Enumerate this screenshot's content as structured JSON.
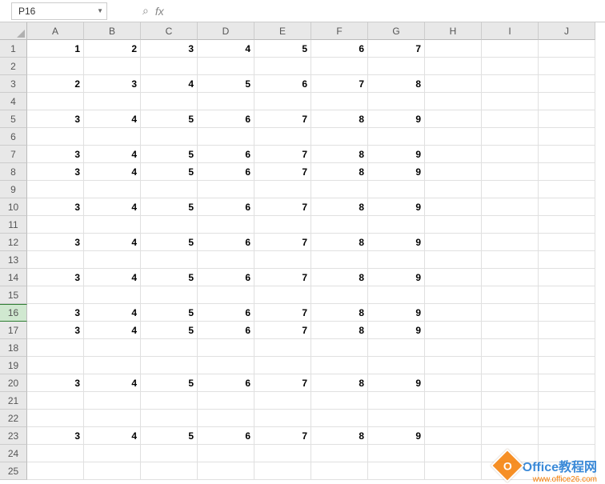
{
  "name_box": "P16",
  "fx_label": "fx",
  "formula_value": "",
  "columns": [
    "A",
    "B",
    "C",
    "D",
    "E",
    "F",
    "G",
    "H",
    "I",
    "J"
  ],
  "row_count": 25,
  "active_row": 16,
  "chart_data": {
    "type": "table",
    "rows": [
      {
        "r": 1,
        "v": [
          "1",
          "2",
          "3",
          "4",
          "5",
          "6",
          "7",
          "",
          "",
          ""
        ]
      },
      {
        "r": 2,
        "v": [
          "",
          "",
          "",
          "",
          "",
          "",
          "",
          "",
          "",
          ""
        ]
      },
      {
        "r": 3,
        "v": [
          "2",
          "3",
          "4",
          "5",
          "6",
          "7",
          "8",
          "",
          "",
          ""
        ]
      },
      {
        "r": 4,
        "v": [
          "",
          "",
          "",
          "",
          "",
          "",
          "",
          "",
          "",
          ""
        ]
      },
      {
        "r": 5,
        "v": [
          "3",
          "4",
          "5",
          "6",
          "7",
          "8",
          "9",
          "",
          "",
          ""
        ]
      },
      {
        "r": 6,
        "v": [
          "",
          "",
          "",
          "",
          "",
          "",
          "",
          "",
          "",
          ""
        ]
      },
      {
        "r": 7,
        "v": [
          "3",
          "4",
          "5",
          "6",
          "7",
          "8",
          "9",
          "",
          "",
          ""
        ]
      },
      {
        "r": 8,
        "v": [
          "3",
          "4",
          "5",
          "6",
          "7",
          "8",
          "9",
          "",
          "",
          ""
        ]
      },
      {
        "r": 9,
        "v": [
          "",
          "",
          "",
          "",
          "",
          "",
          "",
          "",
          "",
          ""
        ]
      },
      {
        "r": 10,
        "v": [
          "3",
          "4",
          "5",
          "6",
          "7",
          "8",
          "9",
          "",
          "",
          ""
        ]
      },
      {
        "r": 11,
        "v": [
          "",
          "",
          "",
          "",
          "",
          "",
          "",
          "",
          "",
          ""
        ]
      },
      {
        "r": 12,
        "v": [
          "3",
          "4",
          "5",
          "6",
          "7",
          "8",
          "9",
          "",
          "",
          ""
        ]
      },
      {
        "r": 13,
        "v": [
          "",
          "",
          "",
          "",
          "",
          "",
          "",
          "",
          "",
          ""
        ]
      },
      {
        "r": 14,
        "v": [
          "3",
          "4",
          "5",
          "6",
          "7",
          "8",
          "9",
          "",
          "",
          ""
        ]
      },
      {
        "r": 15,
        "v": [
          "",
          "",
          "",
          "",
          "",
          "",
          "",
          "",
          "",
          ""
        ]
      },
      {
        "r": 16,
        "v": [
          "3",
          "4",
          "5",
          "6",
          "7",
          "8",
          "9",
          "",
          "",
          ""
        ]
      },
      {
        "r": 17,
        "v": [
          "3",
          "4",
          "5",
          "6",
          "7",
          "8",
          "9",
          "",
          "",
          ""
        ]
      },
      {
        "r": 18,
        "v": [
          "",
          "",
          "",
          "",
          "",
          "",
          "",
          "",
          "",
          ""
        ]
      },
      {
        "r": 19,
        "v": [
          "",
          "",
          "",
          "",
          "",
          "",
          "",
          "",
          "",
          ""
        ]
      },
      {
        "r": 20,
        "v": [
          "3",
          "4",
          "5",
          "6",
          "7",
          "8",
          "9",
          "",
          "",
          ""
        ]
      },
      {
        "r": 21,
        "v": [
          "",
          "",
          "",
          "",
          "",
          "",
          "",
          "",
          "",
          ""
        ]
      },
      {
        "r": 22,
        "v": [
          "",
          "",
          "",
          "",
          "",
          "",
          "",
          "",
          "",
          ""
        ]
      },
      {
        "r": 23,
        "v": [
          "3",
          "4",
          "5",
          "6",
          "7",
          "8",
          "9",
          "",
          "",
          ""
        ]
      },
      {
        "r": 24,
        "v": [
          "",
          "",
          "",
          "",
          "",
          "",
          "",
          "",
          "",
          ""
        ]
      },
      {
        "r": 25,
        "v": [
          "",
          "",
          "",
          "",
          "",
          "",
          "",
          "",
          "",
          ""
        ]
      }
    ]
  },
  "watermark": {
    "badge": "O",
    "text": "Office教程网",
    "sub": "www.office26.com"
  }
}
